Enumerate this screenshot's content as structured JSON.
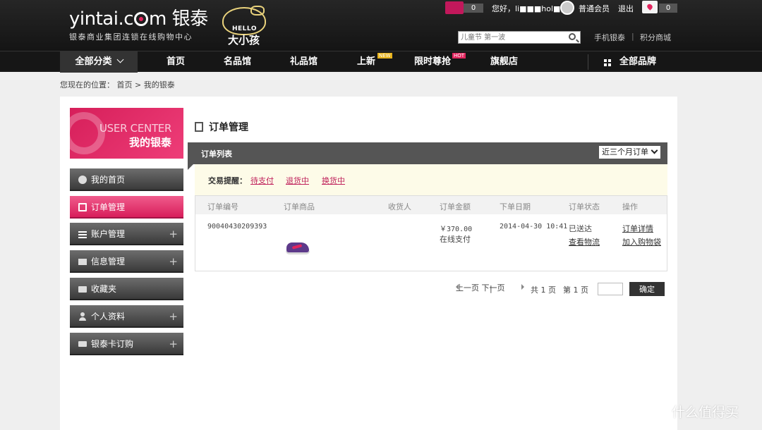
{
  "header": {
    "logo_text": "yintai.c",
    "logo_text_after": "m 银泰",
    "logo_sub": "银泰商业集团连锁在线购物中心",
    "kitty_hello": "HELLO",
    "kitty_big": "大小孩",
    "cart_count": "0",
    "greeting": "您好，li■■■hol■■6",
    "member_level": "普通会员",
    "logout": "退出",
    "message_count": "0",
    "search_placeholder": "儿童节 第一波",
    "mobile_link": "手机银泰",
    "separator": "|",
    "points_link": "积分商城"
  },
  "nav": {
    "all_categories": "全部分类",
    "home": "首页",
    "famous": "名品馆",
    "gifts": "礼品馆",
    "new_arrivals": "上新",
    "new_badge": "NEW",
    "flash_sale": "限时尊抢",
    "hot_badge": "HOT",
    "flagship": "旗舰店",
    "all_brands": "全部品牌"
  },
  "breadcrumb": {
    "prefix": "您现在的位置：",
    "home": "首页",
    "sep": ">",
    "current": "我的银泰"
  },
  "sidebar": {
    "banner_en": "USER CENTER",
    "banner_cn": "我的银泰",
    "items": [
      {
        "label": "我的首页"
      },
      {
        "label": "订单管理"
      },
      {
        "label": "账户管理",
        "plus": "+"
      },
      {
        "label": "信息管理",
        "plus": "+"
      },
      {
        "label": "收藏夹"
      },
      {
        "label": "个人资料",
        "plus": "+"
      },
      {
        "label": "银泰卡订购",
        "plus": "+"
      }
    ]
  },
  "orders": {
    "title": "订单管理",
    "list_label": "订单列表",
    "filter": "近三个月订单",
    "reminder_label": "交易提醒：",
    "reminders": [
      "待支付",
      "退货中",
      "换货中"
    ],
    "columns": [
      "订单编号",
      "订单商品",
      "收货人",
      "订单金额",
      "下单日期",
      "订单状态",
      "操作"
    ],
    "rows": [
      {
        "order_no": "90040430209393",
        "amount": "￥370.00",
        "payment": "在线支付",
        "date": "2014-04-30 10:41",
        "status": "已送达",
        "logistics": "查看物流",
        "detail": "订单详情",
        "add_cart": "加入购物袋"
      }
    ]
  },
  "pager": {
    "prev": "上一页",
    "sep": "|",
    "next": "下一页",
    "total": "共 1 页",
    "current": "第 1 页",
    "confirm": "确定"
  },
  "watermark": "什么值得买"
}
